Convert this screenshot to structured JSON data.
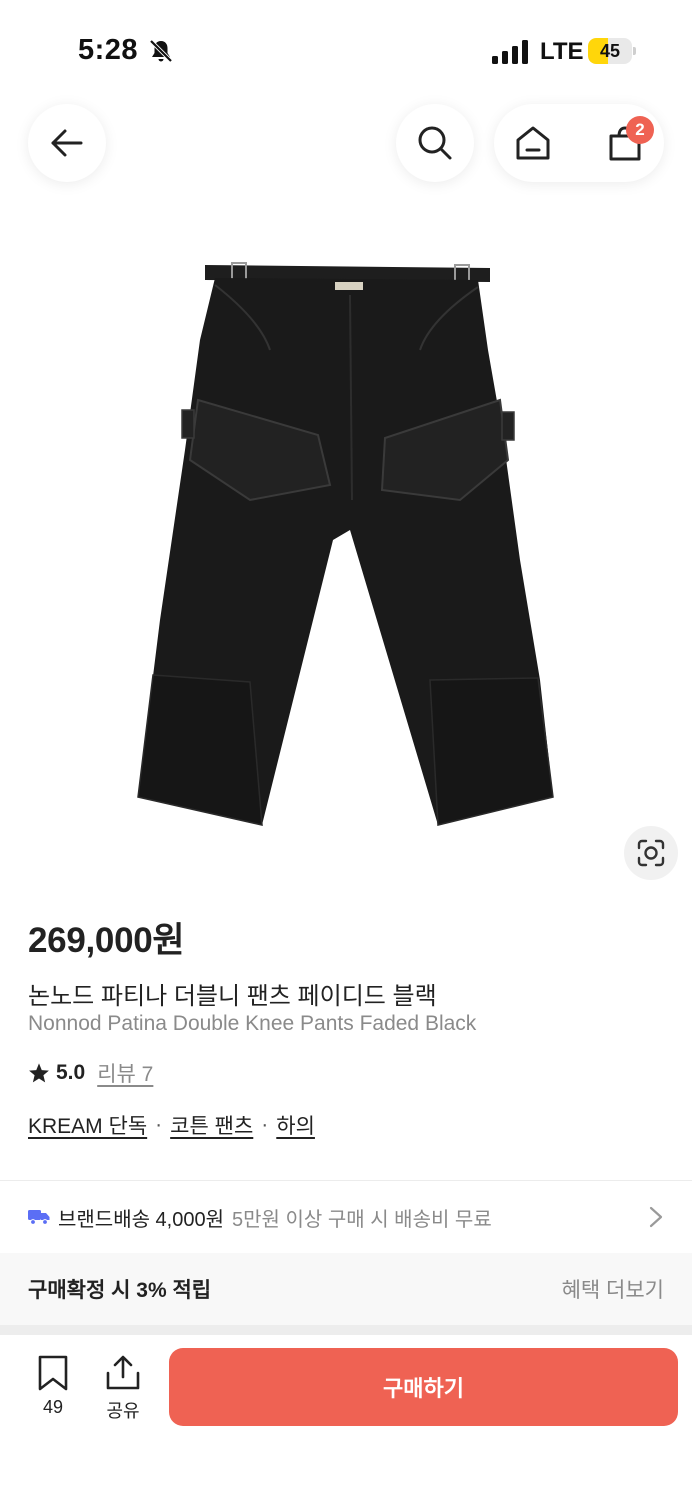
{
  "status_bar": {
    "time": "5:28",
    "network": "LTE",
    "battery": "45",
    "battery_level": 0.45,
    "icons": [
      "bell-slash-icon",
      "signal-icon",
      "battery-icon"
    ]
  },
  "top_nav": {
    "icons": [
      "back-arrow-icon",
      "search-icon",
      "home-icon",
      "cart-icon"
    ],
    "cart_badge": "2"
  },
  "product": {
    "price": "269,000원",
    "name_ko": "논노드 파티나 더블니 팬츠 페이디드 블랙",
    "name_en": "Nonnod Patina Double Knee Pants Faded Black",
    "rating": "5.0",
    "review_label": "리뷰 7",
    "tags": [
      "KREAM 단독",
      "코튼 팬츠",
      "하의"
    ],
    "tag_separator": "·"
  },
  "shipping": {
    "label": "브랜드배송 4,000원",
    "note": "5만원 이상 구매 시 배송비 무료",
    "accent_color": "#5b6ef5"
  },
  "points": {
    "label": "구매확정 시 3% 적립",
    "more": "혜택 더보기"
  },
  "bottom_bar": {
    "bookmark_count": "49",
    "share_label": "공유",
    "buy_label": "구매하기",
    "buy_color": "#ef6253"
  }
}
